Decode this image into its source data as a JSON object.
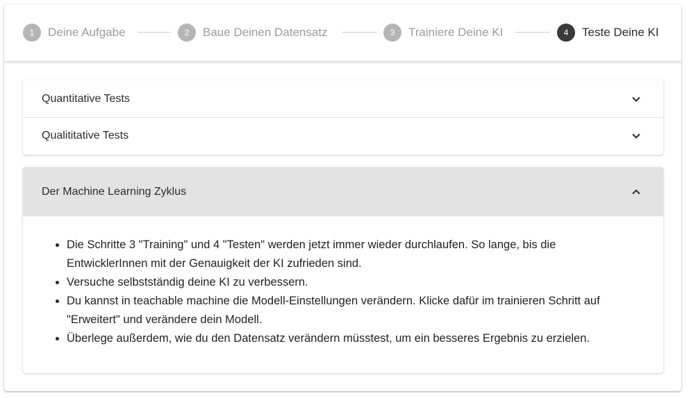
{
  "stepper": {
    "steps": [
      {
        "number": "1",
        "label": "Deine Aufgabe",
        "active": false
      },
      {
        "number": "2",
        "label": "Baue Deinen Datensatz",
        "active": false
      },
      {
        "number": "3",
        "label": "Trainiere Deine KI",
        "active": false
      },
      {
        "number": "4",
        "label": "Teste Deine KI",
        "active": true
      }
    ]
  },
  "accordion": {
    "items": [
      {
        "label": "Quantitative Tests",
        "expanded": false
      },
      {
        "label": "Qualititative Tests",
        "expanded": false
      }
    ],
    "open_section": {
      "label": "Der Machine Learning Zyklus",
      "expanded": true,
      "bullets": [
        "Die Schritte 3 \"Training\" und 4 \"Testen\" werden jetzt immer wieder durchlaufen. So lange, bis die EntwicklerInnen mit der Genauigkeit der KI zufrieden sind.",
        "Versuche selbstständig deine KI zu verbessern.",
        "Du kannst in teachable machine die Modell-Einstellungen verändern. Klicke dafür im trainieren Schritt auf \"Erweitert\" und verändere dein Modell.",
        "Überlege außerdem, wie du den Datensatz verändern müsstest, um ein besseres Ergebnis zu erzielen."
      ]
    }
  },
  "colors": {
    "step_inactive": "#b5b5b5",
    "step_active": "#3a3a3a",
    "open_header_bg": "#e3e3e3"
  }
}
